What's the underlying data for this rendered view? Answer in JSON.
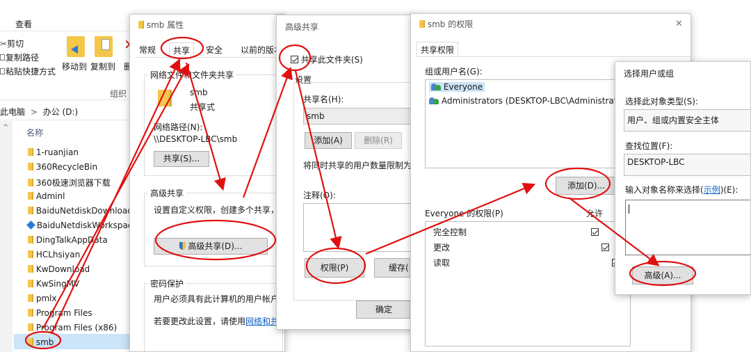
{
  "explorer": {
    "ribbon_tab": "查看",
    "clipboard": {
      "cut": "剪切",
      "copy_path": "复制路径",
      "paste_shortcut": "粘贴快捷方式"
    },
    "move_to": "移动到",
    "copy_to": "复制到",
    "delete_partial": "删",
    "group_label": "组织",
    "breadcrumb": {
      "pc": "此电脑",
      "separator": ">",
      "drive": "办公 (D:)"
    },
    "column_name": "名称",
    "files": [
      "1-ruanjian",
      "360RecycleBin",
      "360极速浏览器下载",
      "Adminl",
      "BaiduNetdiskDownload",
      "BaiduNetdiskWorkspace",
      "DingTalkAppData",
      "HCLhsiyan",
      "KwDownload",
      "KwSingMV",
      "pmlx",
      "Program Files",
      "Program Files (x86)",
      "smb"
    ]
  },
  "props": {
    "title": "smb 属性",
    "tabs": [
      "常规",
      "共享",
      "安全",
      "以前的版本"
    ],
    "net_group": "网络文件和文件夹共享",
    "folder_name": "smb",
    "folder_state": "共享式",
    "net_path_label": "网络路径(N):",
    "net_path": "\\\\DESKTOP-LBC\\smb",
    "share_button": "共享(S)...",
    "adv_group": "高级共享",
    "adv_desc": "设置自定义权限，创建多个共享，并",
    "adv_button": "高级共享(D)...",
    "pwd_group": "密码保护",
    "pwd_desc": "用户必须具有此计算机的用户帐户和",
    "change_prefix": "若要更改此设置，请使用",
    "change_link": "网络和共享"
  },
  "adv": {
    "title": "高级共享",
    "share_checkbox": "共享此文件夹(S)",
    "settings_group": "设置",
    "share_name_label": "共享名(H):",
    "share_name": "smb",
    "add": "添加(A)",
    "remove": "删除(R)",
    "limit_text": "将同时共享的用户数量限制为",
    "comment_label": "注释(O):",
    "perm_button": "权限(P)",
    "cache_button": "缓存(",
    "ok": "确定"
  },
  "perm": {
    "title": "smb 的权限",
    "tab": "共享权限",
    "groups_label": "组或用户名(G):",
    "users": [
      "Everyone",
      "Administrators (DESKTOP-LBC\\Administrators)"
    ],
    "add_button": "添加(D)...",
    "perm_label": "Everyone 的权限(P)",
    "allow_header": "允许",
    "rows": [
      "完全控制",
      "更改",
      "读取"
    ]
  },
  "select": {
    "title": "选择用户或组",
    "type_label": "选择此对象类型(S):",
    "type_value": "用户、组或内置安全主体",
    "location_label": "查找位置(F):",
    "location_value": "DESKTOP-LBC",
    "enter_prefix": "输入对象名称来选择(",
    "enter_link": "示例",
    "enter_suffix": ")(E):",
    "advanced_button": "高级(A)..."
  },
  "colors": {
    "annotation": "#e01010",
    "link": "#0b5fc4",
    "accent": "#2a6fd6"
  }
}
